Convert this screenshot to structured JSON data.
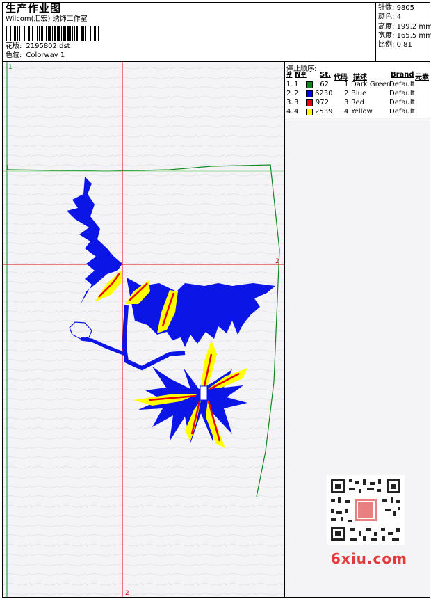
{
  "header": {
    "title": "生产作业图",
    "software": "Wilcom(汇宏) 绣饰工作室",
    "design_label": "花版:",
    "design_value": "2195802.dst",
    "colorway_label": "色位:",
    "colorway_value": "Colorway 1"
  },
  "stats": [
    {
      "label": "针数:",
      "value": "9805"
    },
    {
      "label": "颜色:",
      "value": "4"
    },
    {
      "label": "高度:",
      "value": "199.2 mm"
    },
    {
      "label": "宽度:",
      "value": "165.5 mm"
    },
    {
      "label": "比例:",
      "value": "0.81"
    }
  ],
  "stop_sequence": {
    "title": "停止顺序:",
    "columns": [
      "#",
      "N#",
      "St.",
      "代码",
      "描述",
      "Brand",
      "元素"
    ],
    "rows": [
      {
        "idx": "1.",
        "n": "1",
        "color": "#0a8a1e",
        "stitches": "62",
        "code": "1",
        "desc": "Dark Green",
        "brand": "Default"
      },
      {
        "idx": "2.",
        "n": "2",
        "color": "#0000ee",
        "stitches": "6230",
        "code": "2",
        "desc": "Blue",
        "brand": "Default"
      },
      {
        "idx": "3.",
        "n": "3",
        "color": "#ee0000",
        "stitches": "972",
        "code": "3",
        "desc": "Red",
        "brand": "Default"
      },
      {
        "idx": "4.",
        "n": "4",
        "color": "#ffff00",
        "stitches": "2539",
        "code": "4",
        "desc": "Yellow",
        "brand": "Default"
      }
    ]
  },
  "markers": {
    "top_left": "1",
    "left_mid": "1",
    "right_mid": "2",
    "bottom": "2"
  },
  "watermark": {
    "text": "6xiu.com"
  },
  "colors": {
    "green": "#0a8a1e",
    "blue": "#0b15e6",
    "red": "#ee0000",
    "yellow": "#ffff00",
    "guide_red": "#e00000"
  }
}
